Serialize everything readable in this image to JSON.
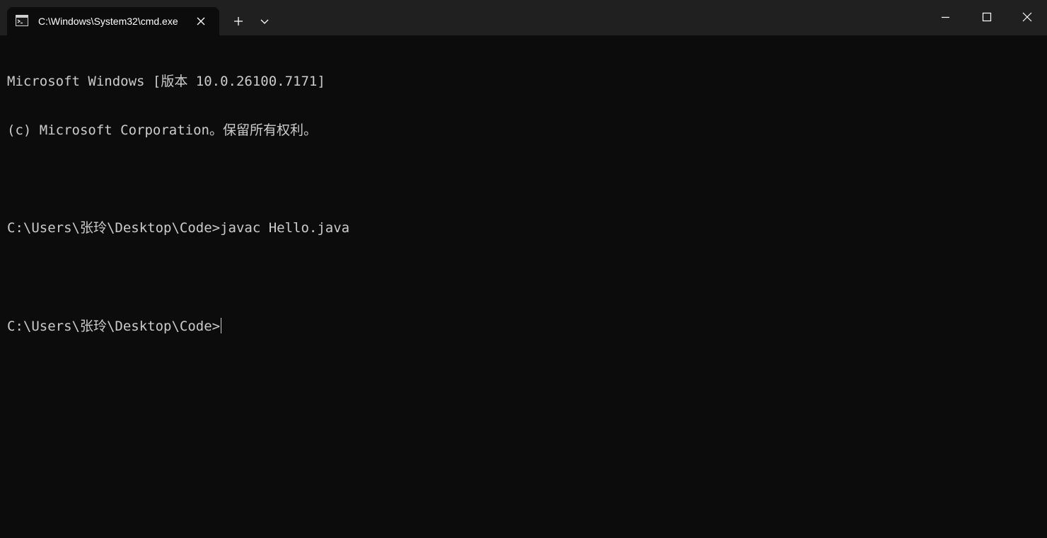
{
  "window": {
    "tab_title": "C:\\Windows\\System32\\cmd.exe",
    "tab_icon": "console-icon",
    "close_tab_icon": "close-icon",
    "new_tab_icon": "plus-icon",
    "dropdown_icon": "chevron-down-icon",
    "minimize_icon": "minimize-icon",
    "maximize_icon": "maximize-icon",
    "close_icon": "close-icon"
  },
  "console": {
    "lines": [
      "Microsoft Windows [版本 10.0.26100.7171]",
      "(c) Microsoft Corporation。保留所有权利。",
      "",
      "C:\\Users\\张玲\\Desktop\\Code>javac Hello.java",
      "",
      "C:\\Users\\张玲\\Desktop\\Code>"
    ]
  },
  "colors": {
    "titlebar_bg": "#202020",
    "console_bg": "#0c0c0c",
    "console_text": "#cccccc"
  }
}
